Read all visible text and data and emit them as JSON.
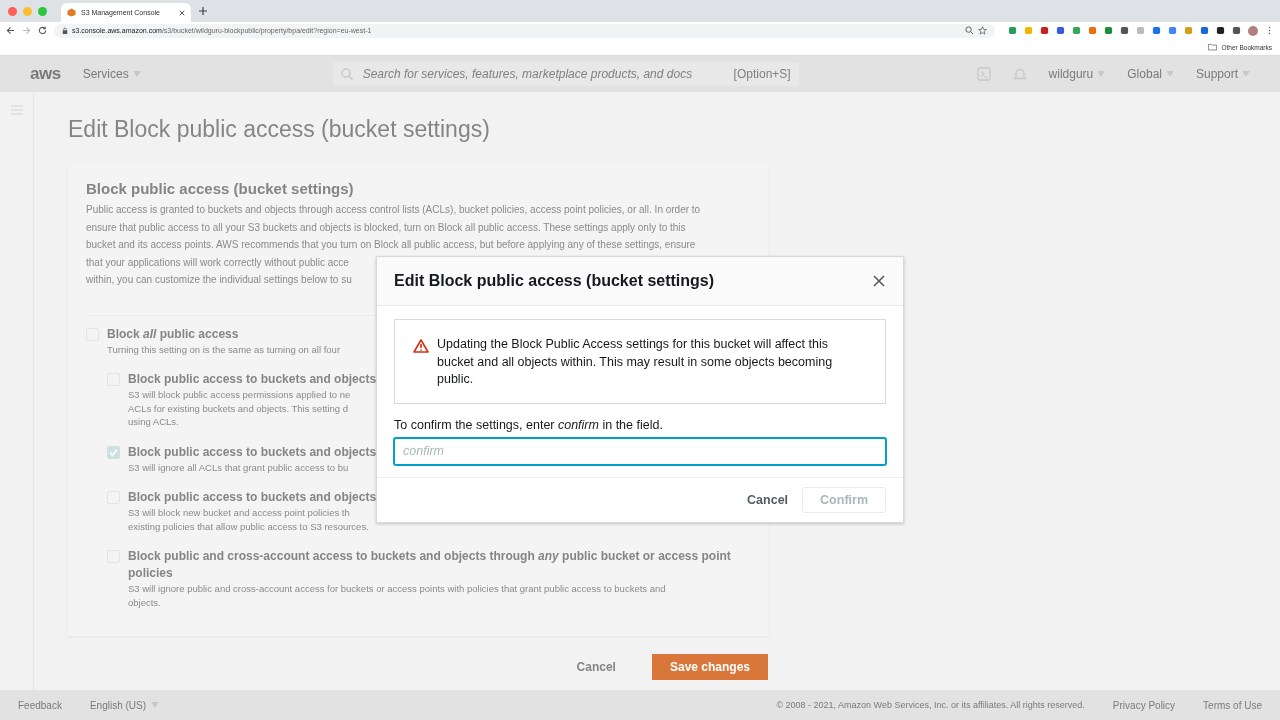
{
  "browser": {
    "tab_title": "S3 Management Console",
    "url_host": "s3.console.aws.amazon.com",
    "url_path": "/s3/bucket/wildguru-blockpublic/property/bpa/edit?region=eu-west-1",
    "bookmark": "Other Bookmarks"
  },
  "nav": {
    "logo": "aws",
    "services": "Services",
    "search_placeholder": "Search for services, features, marketplace products, and docs",
    "shortcut": "[Option+S]",
    "account": "wildguru",
    "region": "Global",
    "support": "Support"
  },
  "page": {
    "title": "Edit Block public access (bucket settings)",
    "card": {
      "heading": "Block public access (bucket settings)",
      "description_lines": [
        "Public access is granted to buckets and objects through access control lists (ACLs), bucket policies, access point policies, or all. In order to",
        "ensure that public access to all your S3 buckets and objects is blocked, turn on Block all public access. These settings apply only to this",
        "bucket and its access points. AWS recommends that you turn on Block all public access, but before applying any of these settings, ensure",
        "that your applications will work correctly without public acce",
        "within, you can customize the individual settings below to su"
      ],
      "settings": [
        {
          "title": "Block *all* public access",
          "description_lines": [
            "Turning this setting on is the same as turning on all four"
          ],
          "checked": false,
          "children": [
            {
              "title": "Block public access to buckets and objects",
              "description_lines": [
                "S3 will block public access permissions applied to ne",
                "ACLs for existing buckets and objects. This setting d",
                "using ACLs."
              ],
              "checked": false
            },
            {
              "title": "Block public access to buckets and objects",
              "description_lines": [
                "S3 will ignore all ACLs that grant public access to bu"
              ],
              "checked": true
            },
            {
              "title": "Block public access to buckets and objects",
              "description_lines": [
                "S3 will block new bucket and access point policies th",
                "existing policies that allow public access to S3 resources."
              ],
              "checked": false
            },
            {
              "title": "Block public and cross-account access to buckets and objects through *any* public bucket or access point policies",
              "description_lines": [
                "S3 will ignore public and cross-account access for buckets or access points with policies that grant public access to buckets and",
                "objects."
              ],
              "checked": false
            }
          ]
        }
      ]
    },
    "cancel": "Cancel",
    "save": "Save changes"
  },
  "modal": {
    "title": "Edit Block public access (bucket settings)",
    "alert": "Updating the Block Public Access settings for this bucket will affect this bucket and all objects within. This may result in some objects becoming public.",
    "instruction": "To confirm the settings, enter *confirm* in the field.",
    "input_placeholder": "confirm",
    "buttons": [
      {
        "label": "Cancel",
        "kind": "link",
        "disabled": false
      },
      {
        "label": "Confirm",
        "kind": "primary",
        "disabled": true
      }
    ]
  },
  "footer": {
    "feedback": "Feedback",
    "language": "English (US)",
    "copyright": "© 2008 - 2021, Amazon Web Services, Inc. or its affiliates. All rights reserved.",
    "privacy": "Privacy Policy",
    "terms": "Terms of Use"
  }
}
